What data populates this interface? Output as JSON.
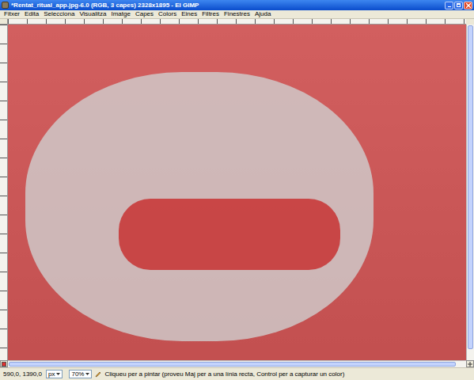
{
  "window": {
    "title": "*Rentat_ritual_app.jpg-6.0 (RGB, 3 capes) 2328x1895 - El GIMP"
  },
  "menu": [
    "Fitxer",
    "Edita",
    "Selecciona",
    "Visualitza",
    "Imatge",
    "Capes",
    "Colors",
    "Eines",
    "Filtres",
    "Finestres",
    "Ajuda"
  ],
  "quick_mask": {
    "on": true
  },
  "scrollbars": {
    "vertical": {
      "level": 0.97
    },
    "horizontal": {
      "level": 0.98
    }
  },
  "status_bar": {
    "coords": "590,0, 1390,0",
    "unit": "px",
    "zoom": "70%",
    "message": "Cliqueu per a pintar (proveu Maj per a una línia recta, Control per a capturar un color)"
  }
}
